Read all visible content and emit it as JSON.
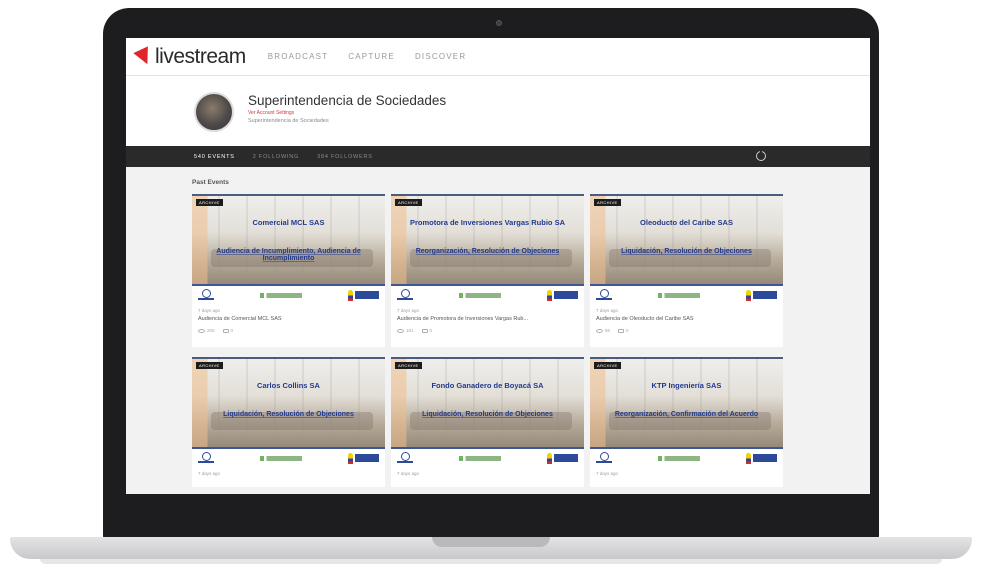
{
  "nav": {
    "logo_text": "livestream",
    "links": [
      "BROADCAST",
      "CAPTURE",
      "DISCOVER"
    ]
  },
  "channel": {
    "title": "Superintendencia de Sociedades",
    "subtitle": "Ver Account Settings",
    "description": "Superintendencia de Sociedades"
  },
  "tabs": [
    {
      "label": "540 EVENTS",
      "active": true
    },
    {
      "label": "2 FOLLOWING",
      "active": false
    },
    {
      "label": "384 FOLLOWERS",
      "active": false
    }
  ],
  "section_title": "Past Events",
  "badge_label": "ARCHIVE",
  "events": [
    {
      "overlay_name": "Comercial MCL SAS",
      "overlay_desc": "Audiencia de Incumplimiento, Audiencia de Incumplimiento",
      "time": "7 days ago",
      "title": "Audiencia de Comercial MCL SAS",
      "views": "200",
      "comments": "0"
    },
    {
      "overlay_name": "Promotora de Inversiones Vargas Rubio SA",
      "overlay_desc": "Reorganización, Resolución de Objeciones",
      "time": "7 days ago",
      "title": "Audiencia de Promotora de Inversiones Vargas Rub...",
      "views": "181",
      "comments": "0"
    },
    {
      "overlay_name": "Oleoducto del Caribe SAS",
      "overlay_desc": "Liquidación, Resolución de Objeciones",
      "time": "7 days ago",
      "title": "Audiencia de Oleoducto del Caribe SAS",
      "views": "86",
      "comments": "0"
    },
    {
      "overlay_name": "Carlos Collins SA",
      "overlay_desc": "Liquidación, Resolución de Objeciones",
      "time": "7 days ago",
      "title": "",
      "views": "",
      "comments": ""
    },
    {
      "overlay_name": "Fondo Ganadero de Boyacá SA",
      "overlay_desc": "Liquidación, Resolución de Objeciones",
      "time": "7 days ago",
      "title": "",
      "views": "",
      "comments": ""
    },
    {
      "overlay_name": "KTP Ingeniería SAS",
      "overlay_desc": "Reorganización, Confirmación del Acuerdo",
      "time": "7 days ago",
      "title": "",
      "views": "",
      "comments": ""
    }
  ],
  "colors": {
    "accent_red": "#e0262b",
    "tab_bar": "#2a2a2a",
    "overlay_blue": "#213a8f"
  }
}
